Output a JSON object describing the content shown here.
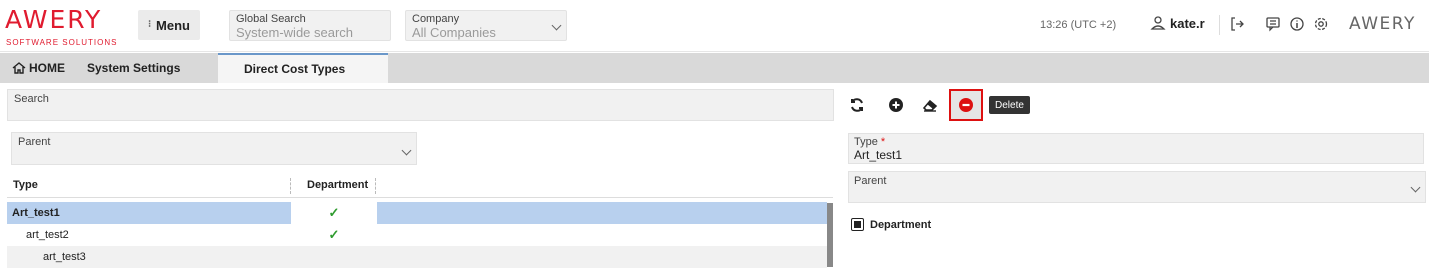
{
  "brand": {
    "logo_text": "AWERY",
    "logo_sub": "SOFTWARE SOLUTIONS",
    "accent": "#e01b2f",
    "logo_right": "AWERY"
  },
  "header": {
    "menu_label": "Menu",
    "global_search": {
      "label": "Global Search",
      "placeholder": "System-wide search"
    },
    "company": {
      "label": "Company",
      "value": "All Companies"
    },
    "time": "13:26 (UTC +2)",
    "user": "kate.r",
    "icons": [
      "logout-icon",
      "chat-icon",
      "info-icon",
      "settings-icon"
    ]
  },
  "tabs": [
    {
      "label": "HOME",
      "icon": "home-icon"
    },
    {
      "label": "System Settings"
    },
    {
      "label": "Direct Cost Types",
      "active": true
    }
  ],
  "search": {
    "label": "Search"
  },
  "toolbar": {
    "buttons": [
      "refresh-icon",
      "add-icon",
      "eraser-icon",
      "delete-icon"
    ],
    "tooltip": "Delete"
  },
  "filter": {
    "parent_label": "Parent"
  },
  "grid": {
    "columns": [
      "Type",
      "Department"
    ],
    "rows": [
      {
        "type": "Art_test1",
        "department": true,
        "selected": true,
        "level": 0
      },
      {
        "type": "art_test2",
        "department": true,
        "level": 1
      },
      {
        "type": "art_test3",
        "department": false,
        "level": 2
      }
    ]
  },
  "form": {
    "type_label": "Type",
    "required_mark": "*",
    "type_value": "Art_test1",
    "parent_label": "Parent",
    "department_label": "Department",
    "department_checked": true
  }
}
